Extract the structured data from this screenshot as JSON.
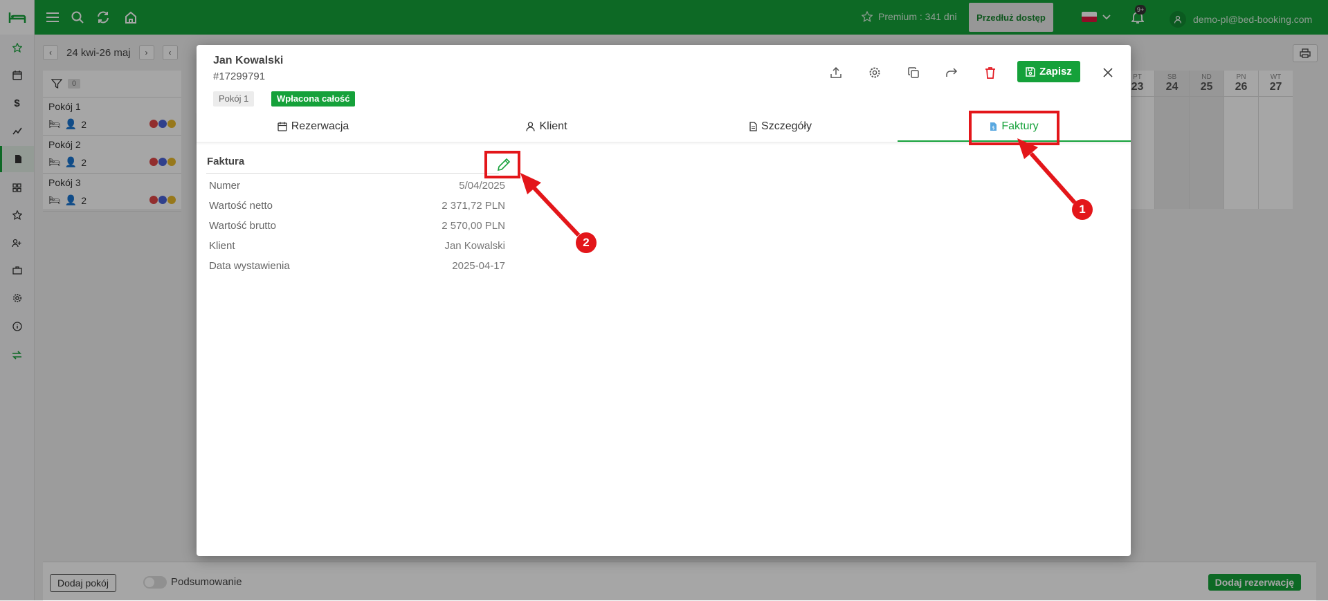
{
  "topbar": {
    "premium_label": "Premium : 341 dni",
    "extend_button": "Przedłuż dostęp",
    "notifications_badge": "9+",
    "user_email": "demo-pl@bed-booking.com"
  },
  "calendar": {
    "date_range": "24 kwi-26 maj",
    "filter_count": "0",
    "rooms": [
      {
        "name": "Pokój 1",
        "guests": "2"
      },
      {
        "name": "Pokój 2",
        "guests": "2"
      },
      {
        "name": "Pokój 3",
        "guests": "2"
      }
    ],
    "days": [
      {
        "dow": "PT",
        "num": "23"
      },
      {
        "dow": "SB",
        "num": "24"
      },
      {
        "dow": "ND",
        "num": "25"
      },
      {
        "dow": "PN",
        "num": "26"
      },
      {
        "dow": "WT",
        "num": "27"
      }
    ]
  },
  "bottom": {
    "add_room": "Dodaj pokój",
    "summary": "Podsumowanie",
    "add_reservation": "Dodaj rezerwację"
  },
  "modal": {
    "guest_name": "Jan Kowalski",
    "reservation_id": "#17299791",
    "room_tag": "Pokój 1",
    "payment_tag": "Wpłacona całość",
    "save_label": "Zapisz",
    "tabs": [
      "Rezerwacja",
      "Klient",
      "Szczegóły",
      "Faktury"
    ],
    "active_tab": "Faktury",
    "invoice": {
      "title": "Faktura",
      "rows": [
        {
          "label": "Numer",
          "value": "5/04/2025"
        },
        {
          "label": "Wartość netto",
          "value": "2 371,72 PLN"
        },
        {
          "label": "Wartość brutto",
          "value": "2 570,00 PLN"
        },
        {
          "label": "Klient",
          "value": "Jan Kowalski"
        },
        {
          "label": "Data wystawienia",
          "value": "2025-04-17"
        }
      ]
    }
  },
  "annotations": {
    "step1": "1",
    "step2": "2"
  },
  "colors": {
    "brand": "#15a13a",
    "annotation": "#e3161a",
    "delete": "#e31b23"
  }
}
